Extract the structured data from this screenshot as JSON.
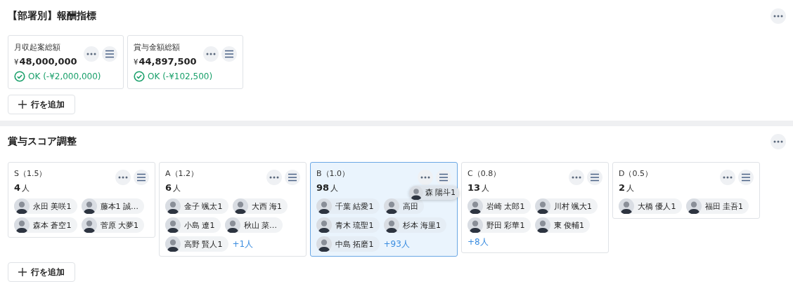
{
  "metrics_section": {
    "title": "【部署別】報酬指標",
    "cards": [
      {
        "label": "月収起案総額",
        "currency": "¥",
        "amount": "48,000,000",
        "status": {
          "kind": "ok",
          "text": "OK (-¥2,000,000)"
        }
      },
      {
        "label": "賞与金額総額",
        "currency": "¥",
        "amount": "44,897,500",
        "status": {
          "kind": "ok",
          "text": "OK (-¥102,500)"
        }
      }
    ],
    "add_button": "行を追加"
  },
  "score_section": {
    "title": "賞与スコア調整",
    "groups": [
      {
        "label": "S（1.5）",
        "count": "4",
        "unit": "人",
        "selected": false,
        "members": [
          "永田 美咲1",
          "藤本1 誠…",
          "森本 蒼空1",
          "菅原 大夢1"
        ]
      },
      {
        "label": "A（1.2）",
        "count": "6",
        "unit": "人",
        "selected": false,
        "members": [
          "金子 颯太1",
          "大西 海1",
          "小島 遼1",
          "秋山 菜…",
          "高野 賢人1"
        ],
        "more": "+1人"
      },
      {
        "label": "B（1.0）",
        "count": "98",
        "unit": "人",
        "selected": true,
        "members": [
          "千葉 結愛1",
          "高田",
          "青木 琉聖1",
          "杉本 海里1",
          "中島 拓磨1"
        ],
        "more": "+93人",
        "dragging": "森 陽斗1"
      },
      {
        "label": "C（0.8）",
        "count": "13",
        "unit": "人",
        "selected": false,
        "members": [
          "岩崎 太郎1",
          "川村 颯大1",
          "野田 彩華1",
          "東 俊輔1"
        ],
        "more": "+8人"
      },
      {
        "label": "D（0.5）",
        "count": "2",
        "unit": "人",
        "selected": false,
        "members": [
          "大橋 優人1",
          "福田 圭吾1"
        ]
      }
    ],
    "add_button": "行を追加"
  }
}
